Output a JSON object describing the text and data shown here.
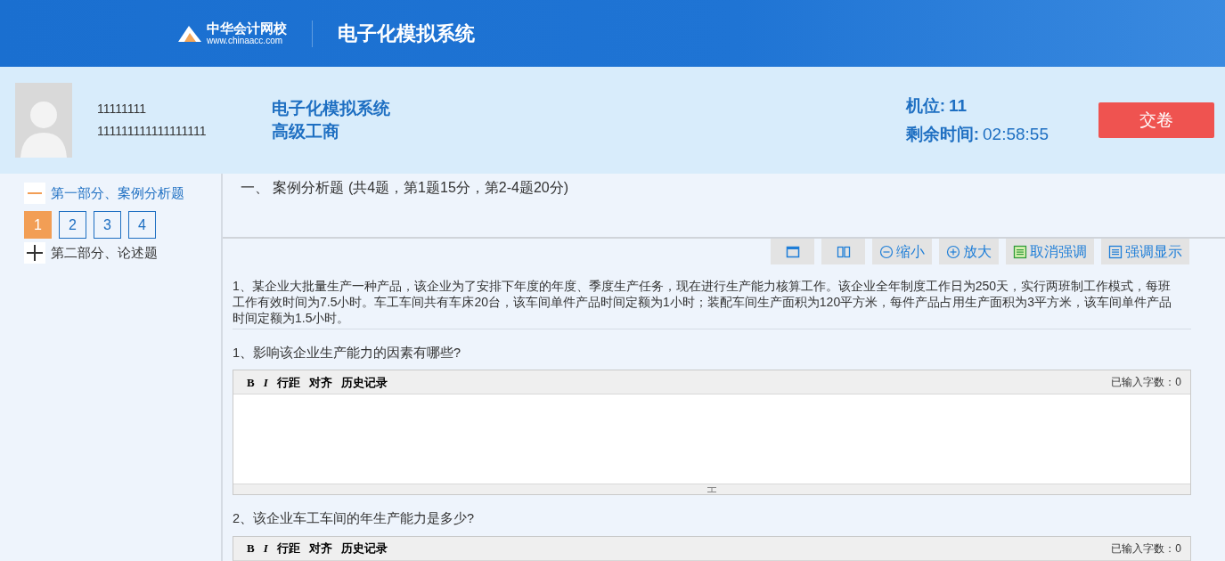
{
  "header": {
    "logo_name": "中华会计网校",
    "logo_url": "www.chinaacc.com",
    "title": "电子化模拟系统"
  },
  "candidate": {
    "id": "11111111",
    "number": "111111111111111111"
  },
  "exam": {
    "name": "电子化模拟系统",
    "level": "高级工商"
  },
  "seat": {
    "label": "机位:",
    "value": "11"
  },
  "timer": {
    "label": "剩余时间:",
    "value": "02:58:55"
  },
  "submit_button": "交卷",
  "sidebar": {
    "sections": [
      {
        "label": "第一部分、案例分析题",
        "expanded": true,
        "questions": [
          {
            "number": "1",
            "selected": true
          },
          {
            "number": "2",
            "selected": false
          },
          {
            "number": "3",
            "selected": false
          },
          {
            "number": "4",
            "selected": false
          }
        ]
      },
      {
        "label": "第二部分、论述题",
        "expanded": false
      }
    ]
  },
  "main": {
    "heading": "一、 案例分析题 (共4题，第1题15分，第2-4题20分)",
    "toolbar": [
      {
        "kind": "single-column"
      },
      {
        "kind": "two-column"
      },
      {
        "kind": "zoom-out",
        "label": "缩小"
      },
      {
        "kind": "zoom-in",
        "label": "放大"
      },
      {
        "kind": "unhighlight",
        "label": "取消强调"
      },
      {
        "kind": "highlight",
        "label": "强调显示"
      }
    ],
    "case_text": "1、某企业大批量生产一种产品，该企业为了安排下年度的年度、季度生产任务，现在进行生产能力核算工作。该企业全年制度工作日为250天，实行两班制工作模式，每班工作有效时间为7.5小时。车工车间共有车床20台，该车间单件产品时间定额为1小时；装配车间生产面积为120平方米，每件产品占用生产面积为3平方米，该车间单件产品时间定额为1.5小时。",
    "questions": [
      {
        "prompt": "1、影响该企业生产能力的因素有哪些?",
        "tools": [
          "B",
          "I",
          "行距",
          "对齐",
          "历史记录"
        ],
        "count": "已输入字数：0"
      },
      {
        "prompt": "2、该企业车工车间的年生产能力是多少?",
        "tools": [
          "B",
          "I",
          "行距",
          "对齐",
          "历史记录"
        ],
        "count": "已输入字数：0"
      }
    ]
  }
}
